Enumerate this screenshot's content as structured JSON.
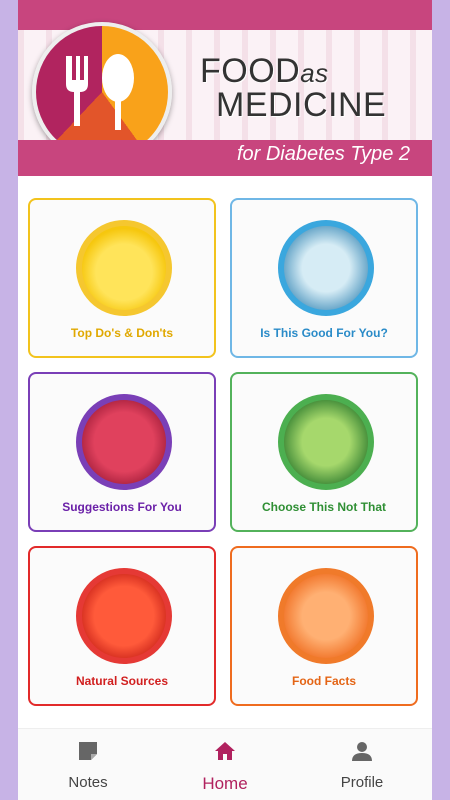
{
  "header": {
    "title_line1_food": "FOOD",
    "title_line1_as": "as",
    "title_line2": "MEDICINE",
    "tagline": "for Diabetes Type 2"
  },
  "cards": [
    {
      "label": "Top Do's & Don'ts",
      "icon": "lemon-icon",
      "color": "#e0a800"
    },
    {
      "label": "Is This Good For You?",
      "icon": "cabbage-icon",
      "color": "#2a8bc8"
    },
    {
      "label": "Suggestions For You",
      "icon": "raspberry-icon",
      "color": "#6b21a8"
    },
    {
      "label": "Choose This Not That",
      "icon": "broccoli-icon",
      "color": "#2f8f34"
    },
    {
      "label": "Natural Sources",
      "icon": "pepper-icon",
      "color": "#d11f1f"
    },
    {
      "label": "Food Facts",
      "icon": "carrot-icon",
      "color": "#e46414"
    }
  ],
  "nav": {
    "notes": "Notes",
    "home": "Home",
    "profile": "Profile",
    "active": "Home",
    "active_color": "#b0215e"
  }
}
